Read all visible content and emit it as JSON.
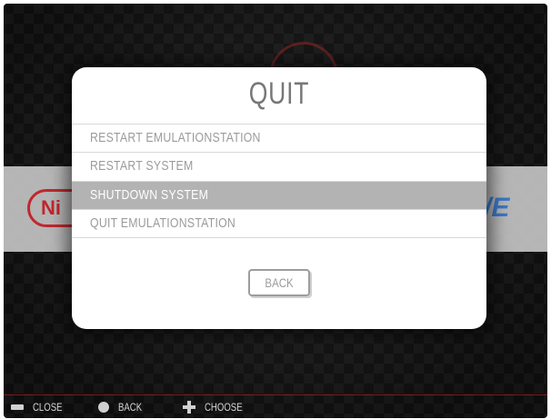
{
  "dialog": {
    "title": "QUIT",
    "menu_items": [
      {
        "label": "RESTART EMULATIONSTATION"
      },
      {
        "label": "RESTART SYSTEM"
      },
      {
        "label": "SHUTDOWN SYSTEM",
        "selected": true
      },
      {
        "label": "QUIT EMULATIONSTATION"
      }
    ],
    "back_label": "BACK"
  },
  "background": {
    "left_logo_text": "Ni",
    "right_logo_text": "/E"
  },
  "help_bar": {
    "items": [
      {
        "icon": "keyboard-icon",
        "label": "CLOSE"
      },
      {
        "icon": "button-b-icon",
        "label": "BACK"
      },
      {
        "icon": "dpad-icon",
        "label": "CHOOSE"
      }
    ]
  },
  "colors": {
    "selected_row": "#b3b3b3",
    "menu_text": "#9b9b9b",
    "accent_red": "#7a1b1b"
  }
}
